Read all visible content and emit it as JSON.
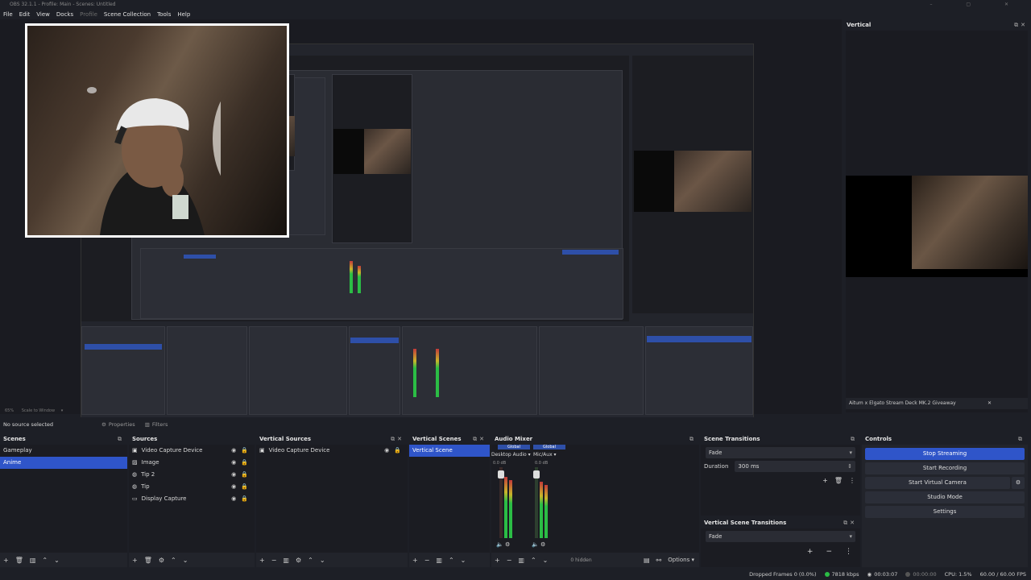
{
  "window": {
    "title": "OBS 32.1.1 - Profile: Main - Scenes: Untitled"
  },
  "menu": [
    "File",
    "Edit",
    "View",
    "Docks",
    "Profile",
    "Scene Collection",
    "Tools",
    "Help"
  ],
  "zoom": {
    "percent": "65%",
    "fit": "Scale to Window"
  },
  "vertical": {
    "title": "Vertical",
    "status_text": "Aitum x Elgato Stream Deck MK.2 Giveaway"
  },
  "source_bar": {
    "no_source": "No source selected",
    "properties": "Properties",
    "filters": "Filters"
  },
  "scenes": {
    "title": "Scenes",
    "items": [
      "Gameplay",
      "Anime"
    ],
    "selected": 1
  },
  "sources": {
    "title": "Sources",
    "items": [
      "Video Capture Device",
      "Image",
      "Tip 2",
      "Tip",
      "Display Capture"
    ]
  },
  "vertical_sources": {
    "title": "Vertical Sources",
    "items": [
      "Video Capture Device"
    ]
  },
  "vertical_scenes": {
    "title": "Vertical Scenes",
    "items": [
      "Vertical Scene"
    ]
  },
  "audio_mixer": {
    "title": "Audio Mixer",
    "global_label": "Global",
    "channels": [
      {
        "name": "Desktop Audio",
        "db": "0.0 dB"
      },
      {
        "name": "Mic/Aux",
        "db": "0.0 dB"
      }
    ],
    "scale": [
      "-6",
      "-12",
      "-18",
      "-24",
      "-30",
      "-36",
      "-42",
      "-48",
      "-54",
      "-60"
    ],
    "hidden": "0 hidden",
    "options": "Options"
  },
  "scene_transitions": {
    "title": "Scene Transitions",
    "transition": "Fade",
    "duration_label": "Duration",
    "duration_value": "300 ms"
  },
  "vertical_scene_transitions": {
    "title": "Vertical Scene Transitions",
    "transition": "Fade"
  },
  "controls": {
    "title": "Controls",
    "stop_streaming": "Stop Streaming",
    "start_recording": "Start Recording",
    "start_virtual_camera": "Start Virtual Camera",
    "studio_mode": "Studio Mode",
    "settings": "Settings"
  },
  "status": {
    "dropped_frames": "Dropped Frames 0 (0.0%)",
    "bitrate": "7818 kbps",
    "stream_time": "00:03:07",
    "rec_time": "00:00:00",
    "cpu": "CPU: 1.5%",
    "fps": "60.00 / 60.00 FPS"
  },
  "colors": {
    "accent": "#2f55c9",
    "bg": "#1d1f26",
    "live": "#2bbd45"
  }
}
